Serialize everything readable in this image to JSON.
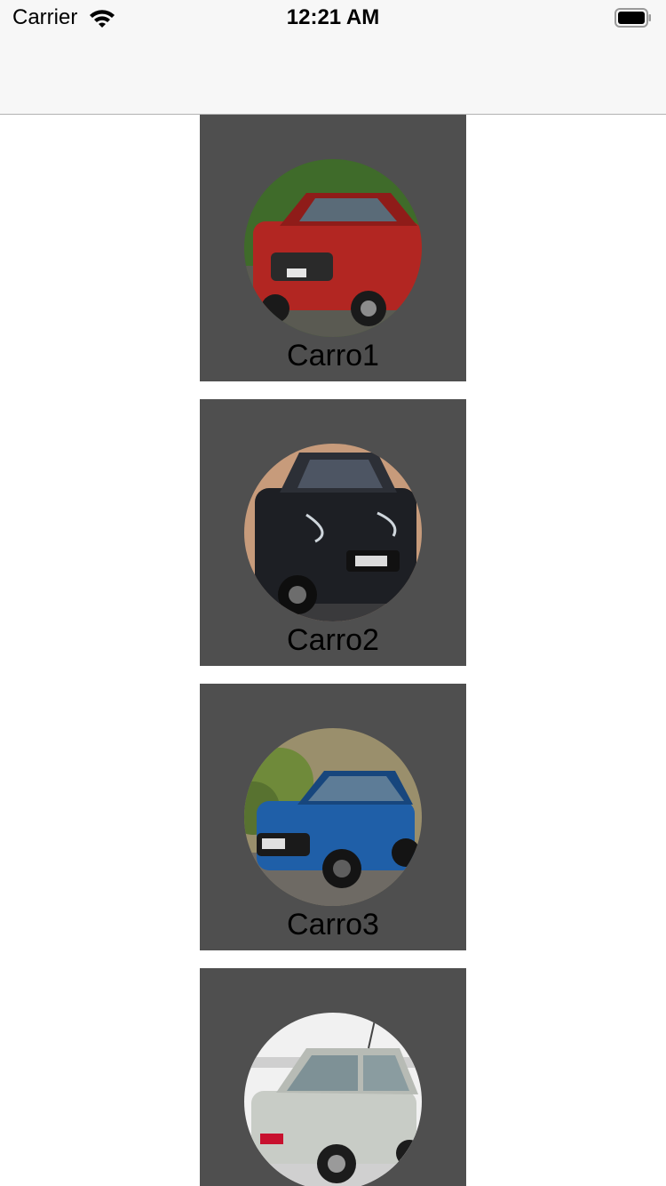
{
  "status_bar": {
    "carrier": "Carrier",
    "time": "12:21 AM"
  },
  "cars": [
    {
      "label": "Carro1",
      "color": "#b22622",
      "sky": "#3f6b2a",
      "ground": "#5a5a52"
    },
    {
      "label": "Carro2",
      "color": "#1d1f24",
      "sky": "#c79b7b",
      "ground": "#3a3a3c"
    },
    {
      "label": "Carro3",
      "color": "#1f5fa8",
      "sky": "#6f8a3a",
      "ground": "#6e6a64"
    },
    {
      "label": "",
      "color": "#c8ccc6",
      "sky": "#eaeaea",
      "ground": "#d8d8d8"
    }
  ],
  "colors": {
    "card_background": "#4f4f4f",
    "bar_background": "#f7f7f7"
  }
}
